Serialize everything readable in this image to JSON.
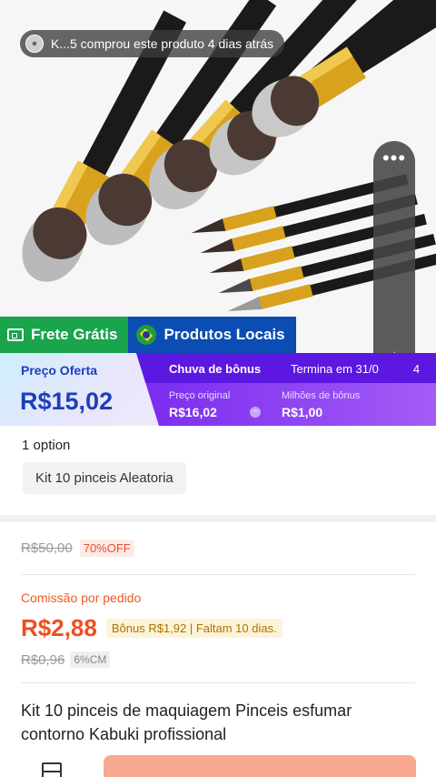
{
  "toast": {
    "avatar_icon": "user-avatar",
    "text": "K...5 comprou este produto 4 dias atrás"
  },
  "float_menu": {
    "more_icon": "more-dots-icon",
    "music_icon": "music-note-icon"
  },
  "badges": {
    "free_shipping": "Frete Grátis",
    "local_products": "Produtos Locais"
  },
  "price_banner": {
    "offer_label": "Preço Oferta",
    "offer_price": "R$15,02",
    "bonus_title": "Chuva de bônus",
    "ends_text": "Termina em 31/0",
    "ends_tail": "4",
    "original_label": "Preço original",
    "original_value": "R$16,02",
    "bonus_label": "Milhões de bônus",
    "bonus_value": "R$1,00"
  },
  "options": {
    "count": "1 option",
    "selected": "Kit 10 pinceis Aleatoria"
  },
  "pricing": {
    "original_price": "R$50,00",
    "discount": "70%OFF",
    "commission_label": "Comissão por pedido",
    "commission_value": "R$2,88",
    "bonus_tag": "Bônus R$1,92  |  Faltam 10 dias.",
    "commission_original": "R$0,96",
    "commission_rate": "6%CM"
  },
  "product_title": "Kit 10 pinceis de maquiagem Pinceis esfumar contorno Kabuki profissional",
  "colors": {
    "green_badge": "#1aa44c",
    "blue_badge": "#0b4db2",
    "price_blue": "#1d3fb8",
    "purple": "#7a2bf0",
    "orange": "#f04d1f"
  }
}
